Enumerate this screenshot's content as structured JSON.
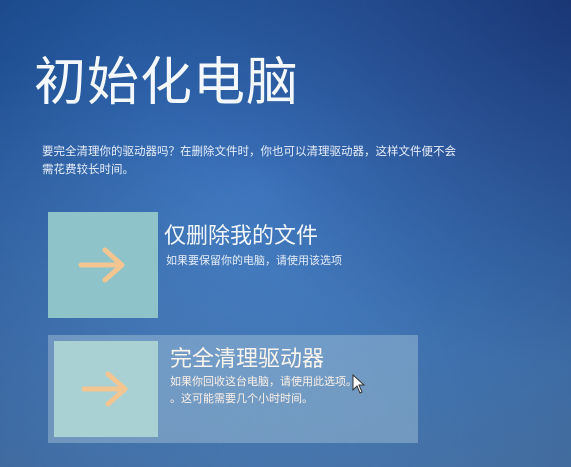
{
  "screen": {
    "title": "初始化电脑",
    "description_lines": [
      "要完全清理你的驱动器吗？在删除文件时，你也可以清理驱动器，这样文件便不会",
      "需花费较长时间。"
    ]
  },
  "options": [
    {
      "title": "仅删除我的文件",
      "description_lines": [
        "如果要保留你的电脑，请使用该选项"
      ],
      "icon": "arrow-right-icon"
    },
    {
      "title": "完全清理驱动器",
      "description_lines": [
        "如果你回收这台电脑，请使用此选项。",
        "。这可能需要几个小时时间。"
      ],
      "icon": "arrow-right-icon"
    }
  ],
  "colors": {
    "background": "#2d6ab8",
    "tile": "#8ec3c9",
    "tile_selected": "#a9d0d2",
    "arrow": "#f3c590"
  }
}
